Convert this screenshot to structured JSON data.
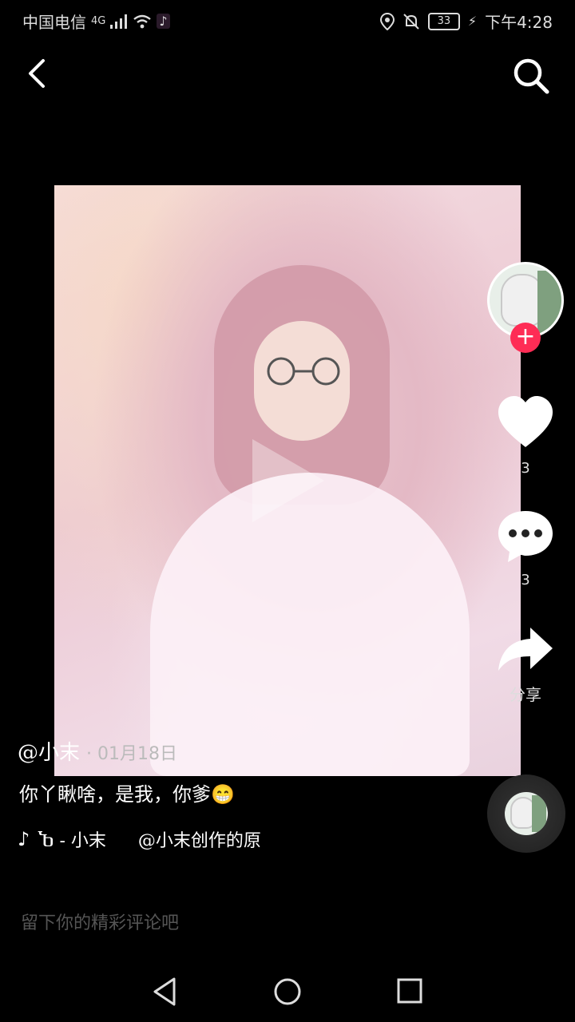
{
  "status_bar": {
    "carrier": "中国电信",
    "network": "4G",
    "battery": "33",
    "time": "下午4:28"
  },
  "top_nav": {
    "back_icon": "chevron-left-icon",
    "search_icon": "search-icon"
  },
  "video": {
    "play_icon": "play-icon"
  },
  "right_rail": {
    "follow_label": "+",
    "like_count": "3",
    "comment_count": "3",
    "share_label": "分享"
  },
  "post": {
    "author": "@小末",
    "date": "· 01月18日",
    "caption": "你丫瞅啥，是我，你爹😁",
    "music_prefix": "Ⴆ - 小末",
    "music_credit": "@小末创作的原"
  },
  "comment_input": {
    "placeholder": "留下你的精彩评论吧"
  },
  "colors": {
    "accent": "#fe2c55",
    "background": "#000000"
  }
}
